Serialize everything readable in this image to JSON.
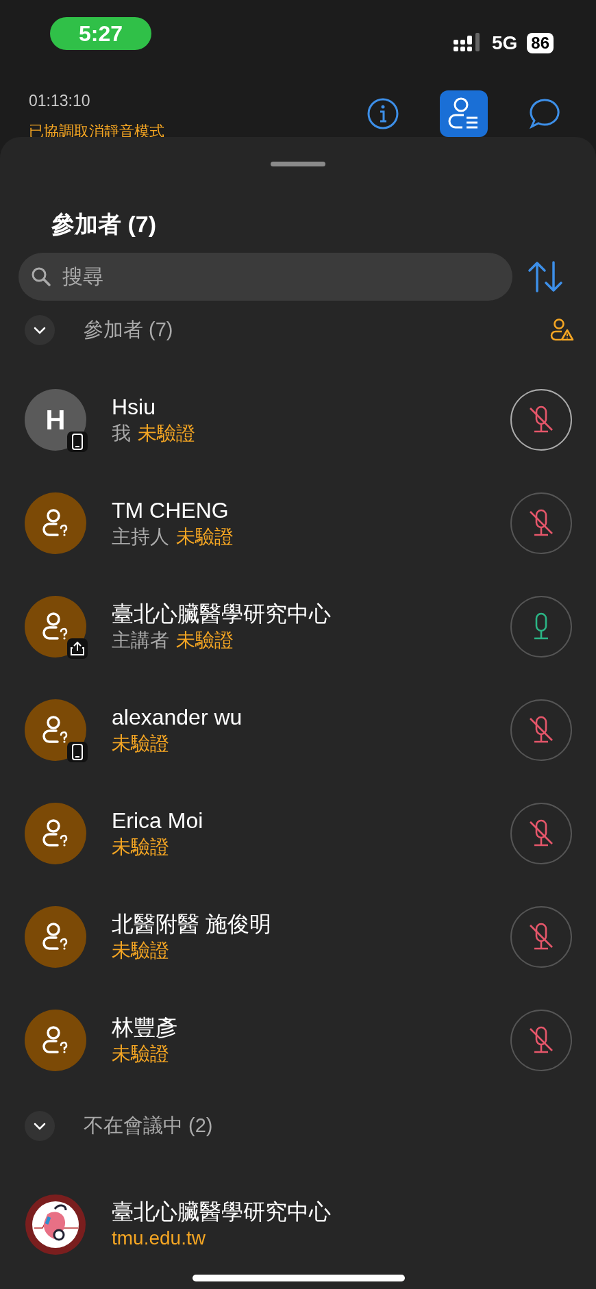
{
  "status_bar": {
    "time": "5:27",
    "network": "5G",
    "battery": "86"
  },
  "header": {
    "timer": "01:13:10",
    "notice": "已協調取消靜音模式"
  },
  "toolbar": [
    {
      "kind": "info",
      "selected": false
    },
    {
      "kind": "participants",
      "selected": true
    },
    {
      "kind": "chat",
      "selected": false
    }
  ],
  "sheet": {
    "title": "參加者 (7)",
    "search": {
      "placeholder": "搜尋"
    }
  },
  "sections": [
    {
      "title": "參加者 (7)",
      "expanded": true,
      "warning": true,
      "participants": [
        {
          "kind": "initial",
          "initial": "H",
          "badge": {
            "kind": "phone"
          },
          "name": "Hsiu",
          "role": "我",
          "status": "未驗證",
          "muted": true,
          "self": true
        },
        {
          "kind": "guest",
          "name": "TM CHENG",
          "role": "主持人",
          "status": "未驗證",
          "muted": true,
          "self": false
        },
        {
          "kind": "guest",
          "badge": {
            "kind": "share"
          },
          "name": "臺北心臟醫學研究中心",
          "role": "主講者",
          "status": "未驗證",
          "muted": false,
          "self": false
        },
        {
          "kind": "guest",
          "badge": {
            "kind": "phone"
          },
          "name": "alexander wu",
          "status": "未驗證",
          "muted": true,
          "self": false
        },
        {
          "kind": "guest",
          "name": "Erica Moi",
          "status": "未驗證",
          "muted": true,
          "self": false
        },
        {
          "kind": "guest",
          "name": "北醫附醫 施俊明",
          "status": "未驗證",
          "muted": true,
          "self": false
        },
        {
          "kind": "guest",
          "name": "林豐彥",
          "status": "未驗證",
          "muted": true,
          "self": false
        }
      ]
    },
    {
      "title": "不在會議中 (2)",
      "expanded": true,
      "participants": [
        {
          "kind": "logo",
          "name": "臺北心臟醫學研究中心",
          "status": "tmu.edu.tw"
        }
      ]
    }
  ]
}
